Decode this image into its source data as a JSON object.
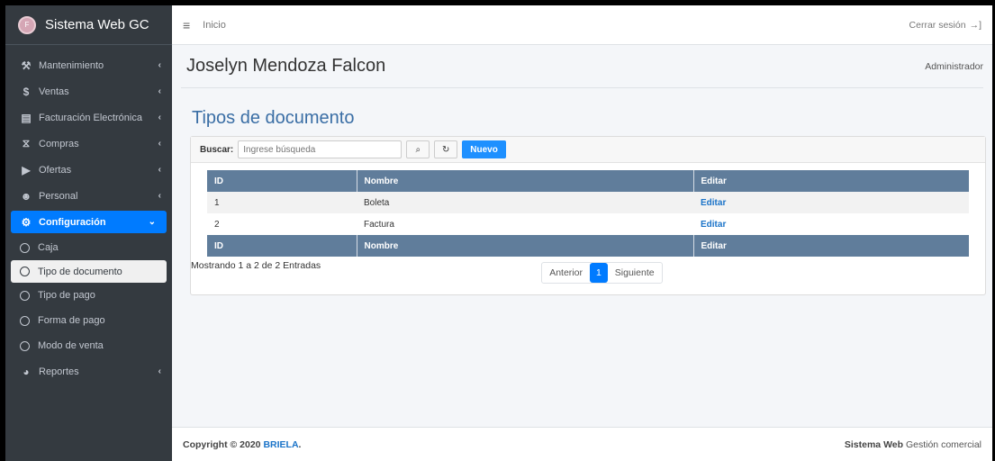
{
  "app": {
    "brand": "Sistema Web GC"
  },
  "sidebar": {
    "items": [
      {
        "label": "Mantenimiento",
        "icon": "wrench-icon",
        "glyph": "⚒"
      },
      {
        "label": "Ventas",
        "icon": "dollar-icon",
        "glyph": "$"
      },
      {
        "label": "Facturación Electrónica",
        "icon": "invoice-icon",
        "glyph": "▤"
      },
      {
        "label": "Compras",
        "icon": "cart-icon",
        "glyph": "⧖"
      },
      {
        "label": "Ofertas",
        "icon": "tags-icon",
        "glyph": "▶"
      },
      {
        "label": "Personal",
        "icon": "users-icon",
        "glyph": "☻"
      }
    ],
    "active": {
      "label": "Configuración",
      "icon": "gear-icon"
    },
    "sub_items": [
      "Caja",
      "Tipo de documento",
      "Tipo de pago",
      "Forma de pago",
      "Modo de venta"
    ],
    "reports": {
      "label": "Reportes",
      "icon": "pie-chart-icon"
    }
  },
  "topbar": {
    "home": "Inicio",
    "logout": "Cerrar sesión"
  },
  "user": {
    "name": "Joselyn Mendoza Falcon",
    "role": "Administrador"
  },
  "page": {
    "title": "Tipos de documento"
  },
  "search": {
    "label": "Buscar:",
    "placeholder": "Ingrese búsqueda",
    "new_button": "Nuevo"
  },
  "table": {
    "headers": [
      "ID",
      "Nombre",
      "Editar"
    ],
    "rows": [
      {
        "id": "1",
        "nombre": "Boleta",
        "editar": "Editar"
      },
      {
        "id": "2",
        "nombre": "Factura",
        "editar": "Editar"
      }
    ]
  },
  "pagination": {
    "info": "Mostrando 1 a 2 de 2 Entradas",
    "prev": "Anterior",
    "current": "1",
    "next": "Siguiente"
  },
  "footer": {
    "copyright": "Copyright © 2020 ",
    "company": "BRIELA",
    "system_bold": "Sistema Web",
    "system_rest": " Gestión comercial"
  },
  "colors": {
    "accent": "#007bff",
    "sidebar": "#343a40",
    "table_header": "#607d9b",
    "title": "#3a6ea5"
  }
}
